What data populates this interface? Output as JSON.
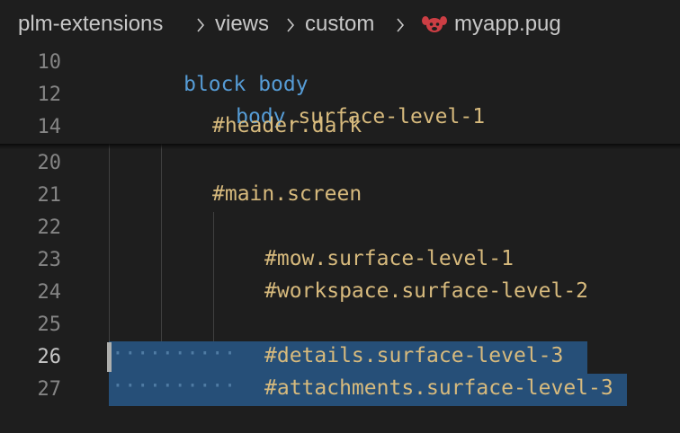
{
  "breadcrumb": {
    "items": [
      "plm-extensions",
      "views",
      "custom"
    ],
    "file_icon": "pug-icon",
    "file_name": "myapp.pug"
  },
  "sticky_lines": [
    {
      "num": "10",
      "kw": "block",
      "rest": " body"
    },
    {
      "num": "12",
      "tag": "body",
      "rest": ".surface-level-1"
    },
    {
      "num": "14",
      "rest": "#header.dark"
    }
  ],
  "lines": [
    {
      "num": "20",
      "text": ""
    },
    {
      "num": "21",
      "text": "#main.screen"
    },
    {
      "num": "22",
      "text": ""
    },
    {
      "num": "23",
      "text": "#mow.surface-level-1"
    },
    {
      "num": "24",
      "text": "#workspace.surface-level-2"
    },
    {
      "num": "25",
      "text": ""
    },
    {
      "num": "26",
      "text": "#details.surface-level-3",
      "active": true
    },
    {
      "num": "27",
      "text": "#attachments.surface-level-3"
    }
  ],
  "colors": {
    "background": "#1e1e1e",
    "keyword": "#569cd6",
    "selector": "#d7ba7d",
    "selection": "#264f78",
    "line_number": "#858585"
  }
}
